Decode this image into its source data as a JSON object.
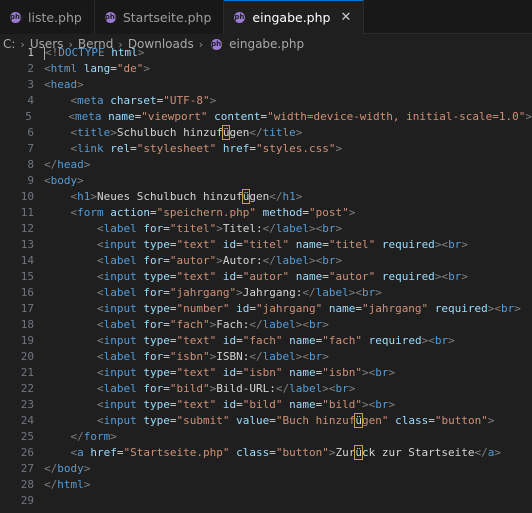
{
  "tabs": [
    {
      "label": "liste.php",
      "active": false
    },
    {
      "label": "Startseite.php",
      "active": false
    },
    {
      "label": "eingabe.php",
      "active": true
    }
  ],
  "close_glyph": "✕",
  "breadcrumb": [
    "C:",
    "Users",
    "Bernd",
    "Downloads",
    "eingabe.php"
  ],
  "breadcrumb_sep": "›",
  "php_icon_text": "php",
  "current_line": 1,
  "colors": {
    "tag": "#569cd6",
    "attr": "#9cdcfe",
    "string": "#ce9178",
    "text": "#d4d4d4",
    "punct": "#808080",
    "accent": "#0078d4"
  },
  "code_lines": [
    [
      [
        "t",
        "<!"
      ],
      [
        "tg",
        "DOCTYPE"
      ],
      [
        "tx",
        " "
      ],
      [
        "at",
        "html"
      ],
      [
        "t",
        ">"
      ]
    ],
    [
      [
        "t",
        "<"
      ],
      [
        "tg",
        "html"
      ],
      [
        "tx",
        " "
      ],
      [
        "at",
        "lang"
      ],
      [
        "tx",
        "="
      ],
      [
        "st",
        "\"de\""
      ],
      [
        "t",
        ">"
      ]
    ],
    [
      [
        "t",
        "<"
      ],
      [
        "tg",
        "head"
      ],
      [
        "t",
        ">"
      ]
    ],
    [
      [
        "tx",
        "    "
      ],
      [
        "t",
        "<"
      ],
      [
        "tg",
        "meta"
      ],
      [
        "tx",
        " "
      ],
      [
        "at",
        "charset"
      ],
      [
        "tx",
        "="
      ],
      [
        "st",
        "\"UTF-8\""
      ],
      [
        "t",
        ">"
      ]
    ],
    [
      [
        "tx",
        "    "
      ],
      [
        "t",
        "<"
      ],
      [
        "tg",
        "meta"
      ],
      [
        "tx",
        " "
      ],
      [
        "at",
        "name"
      ],
      [
        "tx",
        "="
      ],
      [
        "st",
        "\"viewport\""
      ],
      [
        "tx",
        " "
      ],
      [
        "at",
        "content"
      ],
      [
        "tx",
        "="
      ],
      [
        "st",
        "\"width=device-width, initial-scale=1.0\""
      ],
      [
        "t",
        ">"
      ]
    ],
    [
      [
        "tx",
        "    "
      ],
      [
        "t",
        "<"
      ],
      [
        "tg",
        "title"
      ],
      [
        "t",
        ">"
      ],
      [
        "tx",
        "Schulbuch hinzuf"
      ],
      [
        "hl",
        "ü"
      ],
      [
        "tx",
        "gen"
      ],
      [
        "t",
        "</"
      ],
      [
        "tg",
        "title"
      ],
      [
        "t",
        ">"
      ]
    ],
    [
      [
        "tx",
        "    "
      ],
      [
        "t",
        "<"
      ],
      [
        "tg",
        "link"
      ],
      [
        "tx",
        " "
      ],
      [
        "at",
        "rel"
      ],
      [
        "tx",
        "="
      ],
      [
        "st",
        "\"stylesheet\""
      ],
      [
        "tx",
        " "
      ],
      [
        "at",
        "href"
      ],
      [
        "tx",
        "="
      ],
      [
        "st",
        "\"styles.css\""
      ],
      [
        "t",
        ">"
      ]
    ],
    [
      [
        "t",
        "</"
      ],
      [
        "tg",
        "head"
      ],
      [
        "t",
        ">"
      ]
    ],
    [
      [
        "t",
        "<"
      ],
      [
        "tg",
        "body"
      ],
      [
        "t",
        ">"
      ]
    ],
    [
      [
        "tx",
        "    "
      ],
      [
        "t",
        "<"
      ],
      [
        "tg",
        "h1"
      ],
      [
        "t",
        ">"
      ],
      [
        "tx",
        "Neues Schulbuch hinzuf"
      ],
      [
        "hl",
        "ü"
      ],
      [
        "tx",
        "gen"
      ],
      [
        "t",
        "</"
      ],
      [
        "tg",
        "h1"
      ],
      [
        "t",
        ">"
      ]
    ],
    [
      [
        "tx",
        "    "
      ],
      [
        "t",
        "<"
      ],
      [
        "tg",
        "form"
      ],
      [
        "tx",
        " "
      ],
      [
        "at",
        "action"
      ],
      [
        "tx",
        "="
      ],
      [
        "st",
        "\"speichern.php\""
      ],
      [
        "tx",
        " "
      ],
      [
        "at",
        "method"
      ],
      [
        "tx",
        "="
      ],
      [
        "st",
        "\"post\""
      ],
      [
        "t",
        ">"
      ]
    ],
    [
      [
        "tx",
        "        "
      ],
      [
        "t",
        "<"
      ],
      [
        "tg",
        "label"
      ],
      [
        "tx",
        " "
      ],
      [
        "at",
        "for"
      ],
      [
        "tx",
        "="
      ],
      [
        "st",
        "\"titel\""
      ],
      [
        "t",
        ">"
      ],
      [
        "tx",
        "Titel:"
      ],
      [
        "t",
        "</"
      ],
      [
        "tg",
        "label"
      ],
      [
        "t",
        "><"
      ],
      [
        "tg",
        "br"
      ],
      [
        "t",
        ">"
      ]
    ],
    [
      [
        "tx",
        "        "
      ],
      [
        "t",
        "<"
      ],
      [
        "tg",
        "input"
      ],
      [
        "tx",
        " "
      ],
      [
        "at",
        "type"
      ],
      [
        "tx",
        "="
      ],
      [
        "st",
        "\"text\""
      ],
      [
        "tx",
        " "
      ],
      [
        "at",
        "id"
      ],
      [
        "tx",
        "="
      ],
      [
        "st",
        "\"titel\""
      ],
      [
        "tx",
        " "
      ],
      [
        "at",
        "name"
      ],
      [
        "tx",
        "="
      ],
      [
        "st",
        "\"titel\""
      ],
      [
        "tx",
        " "
      ],
      [
        "at",
        "required"
      ],
      [
        "t",
        "><"
      ],
      [
        "tg",
        "br"
      ],
      [
        "t",
        ">"
      ]
    ],
    [
      [
        "tx",
        "        "
      ],
      [
        "t",
        "<"
      ],
      [
        "tg",
        "label"
      ],
      [
        "tx",
        " "
      ],
      [
        "at",
        "for"
      ],
      [
        "tx",
        "="
      ],
      [
        "st",
        "\"autor\""
      ],
      [
        "t",
        ">"
      ],
      [
        "tx",
        "Autor:"
      ],
      [
        "t",
        "</"
      ],
      [
        "tg",
        "label"
      ],
      [
        "t",
        "><"
      ],
      [
        "tg",
        "br"
      ],
      [
        "t",
        ">"
      ]
    ],
    [
      [
        "tx",
        "        "
      ],
      [
        "t",
        "<"
      ],
      [
        "tg",
        "input"
      ],
      [
        "tx",
        " "
      ],
      [
        "at",
        "type"
      ],
      [
        "tx",
        "="
      ],
      [
        "st",
        "\"text\""
      ],
      [
        "tx",
        " "
      ],
      [
        "at",
        "id"
      ],
      [
        "tx",
        "="
      ],
      [
        "st",
        "\"autor\""
      ],
      [
        "tx",
        " "
      ],
      [
        "at",
        "name"
      ],
      [
        "tx",
        "="
      ],
      [
        "st",
        "\"autor\""
      ],
      [
        "tx",
        " "
      ],
      [
        "at",
        "required"
      ],
      [
        "t",
        "><"
      ],
      [
        "tg",
        "br"
      ],
      [
        "t",
        ">"
      ]
    ],
    [
      [
        "tx",
        "        "
      ],
      [
        "t",
        "<"
      ],
      [
        "tg",
        "label"
      ],
      [
        "tx",
        " "
      ],
      [
        "at",
        "for"
      ],
      [
        "tx",
        "="
      ],
      [
        "st",
        "\"jahrgang\""
      ],
      [
        "t",
        ">"
      ],
      [
        "tx",
        "Jahrgang:"
      ],
      [
        "t",
        "</"
      ],
      [
        "tg",
        "label"
      ],
      [
        "t",
        "><"
      ],
      [
        "tg",
        "br"
      ],
      [
        "t",
        ">"
      ]
    ],
    [
      [
        "tx",
        "        "
      ],
      [
        "t",
        "<"
      ],
      [
        "tg",
        "input"
      ],
      [
        "tx",
        " "
      ],
      [
        "at",
        "type"
      ],
      [
        "tx",
        "="
      ],
      [
        "st",
        "\"number\""
      ],
      [
        "tx",
        " "
      ],
      [
        "at",
        "id"
      ],
      [
        "tx",
        "="
      ],
      [
        "st",
        "\"jahrgang\""
      ],
      [
        "tx",
        " "
      ],
      [
        "at",
        "name"
      ],
      [
        "tx",
        "="
      ],
      [
        "st",
        "\"jahrgang\""
      ],
      [
        "tx",
        " "
      ],
      [
        "at",
        "required"
      ],
      [
        "t",
        "><"
      ],
      [
        "tg",
        "br"
      ],
      [
        "t",
        ">"
      ]
    ],
    [
      [
        "tx",
        "        "
      ],
      [
        "t",
        "<"
      ],
      [
        "tg",
        "label"
      ],
      [
        "tx",
        " "
      ],
      [
        "at",
        "for"
      ],
      [
        "tx",
        "="
      ],
      [
        "st",
        "\"fach\""
      ],
      [
        "t",
        ">"
      ],
      [
        "tx",
        "Fach:"
      ],
      [
        "t",
        "</"
      ],
      [
        "tg",
        "label"
      ],
      [
        "t",
        "><"
      ],
      [
        "tg",
        "br"
      ],
      [
        "t",
        ">"
      ]
    ],
    [
      [
        "tx",
        "        "
      ],
      [
        "t",
        "<"
      ],
      [
        "tg",
        "input"
      ],
      [
        "tx",
        " "
      ],
      [
        "at",
        "type"
      ],
      [
        "tx",
        "="
      ],
      [
        "st",
        "\"text\""
      ],
      [
        "tx",
        " "
      ],
      [
        "at",
        "id"
      ],
      [
        "tx",
        "="
      ],
      [
        "st",
        "\"fach\""
      ],
      [
        "tx",
        " "
      ],
      [
        "at",
        "name"
      ],
      [
        "tx",
        "="
      ],
      [
        "st",
        "\"fach\""
      ],
      [
        "tx",
        " "
      ],
      [
        "at",
        "required"
      ],
      [
        "t",
        "><"
      ],
      [
        "tg",
        "br"
      ],
      [
        "t",
        ">"
      ]
    ],
    [
      [
        "tx",
        "        "
      ],
      [
        "t",
        "<"
      ],
      [
        "tg",
        "label"
      ],
      [
        "tx",
        " "
      ],
      [
        "at",
        "for"
      ],
      [
        "tx",
        "="
      ],
      [
        "st",
        "\"isbn\""
      ],
      [
        "t",
        ">"
      ],
      [
        "tx",
        "ISBN:"
      ],
      [
        "t",
        "</"
      ],
      [
        "tg",
        "label"
      ],
      [
        "t",
        "><"
      ],
      [
        "tg",
        "br"
      ],
      [
        "t",
        ">"
      ]
    ],
    [
      [
        "tx",
        "        "
      ],
      [
        "t",
        "<"
      ],
      [
        "tg",
        "input"
      ],
      [
        "tx",
        " "
      ],
      [
        "at",
        "type"
      ],
      [
        "tx",
        "="
      ],
      [
        "st",
        "\"text\""
      ],
      [
        "tx",
        " "
      ],
      [
        "at",
        "id"
      ],
      [
        "tx",
        "="
      ],
      [
        "st",
        "\"isbn\""
      ],
      [
        "tx",
        " "
      ],
      [
        "at",
        "name"
      ],
      [
        "tx",
        "="
      ],
      [
        "st",
        "\"isbn\""
      ],
      [
        "t",
        "><"
      ],
      [
        "tg",
        "br"
      ],
      [
        "t",
        ">"
      ]
    ],
    [
      [
        "tx",
        "        "
      ],
      [
        "t",
        "<"
      ],
      [
        "tg",
        "label"
      ],
      [
        "tx",
        " "
      ],
      [
        "at",
        "for"
      ],
      [
        "tx",
        "="
      ],
      [
        "st",
        "\"bild\""
      ],
      [
        "t",
        ">"
      ],
      [
        "tx",
        "Bild-URL:"
      ],
      [
        "t",
        "</"
      ],
      [
        "tg",
        "label"
      ],
      [
        "t",
        "><"
      ],
      [
        "tg",
        "br"
      ],
      [
        "t",
        ">"
      ]
    ],
    [
      [
        "tx",
        "        "
      ],
      [
        "t",
        "<"
      ],
      [
        "tg",
        "input"
      ],
      [
        "tx",
        " "
      ],
      [
        "at",
        "type"
      ],
      [
        "tx",
        "="
      ],
      [
        "st",
        "\"text\""
      ],
      [
        "tx",
        " "
      ],
      [
        "at",
        "id"
      ],
      [
        "tx",
        "="
      ],
      [
        "st",
        "\"bild\""
      ],
      [
        "tx",
        " "
      ],
      [
        "at",
        "name"
      ],
      [
        "tx",
        "="
      ],
      [
        "st",
        "\"bild\""
      ],
      [
        "t",
        "><"
      ],
      [
        "tg",
        "br"
      ],
      [
        "t",
        ">"
      ]
    ],
    [
      [
        "tx",
        "        "
      ],
      [
        "t",
        "<"
      ],
      [
        "tg",
        "input"
      ],
      [
        "tx",
        " "
      ],
      [
        "at",
        "type"
      ],
      [
        "tx",
        "="
      ],
      [
        "st",
        "\"submit\""
      ],
      [
        "tx",
        " "
      ],
      [
        "at",
        "value"
      ],
      [
        "tx",
        "="
      ],
      [
        "st",
        "\"Buch hinzuf"
      ],
      [
        "hl",
        "ü"
      ],
      [
        "st",
        "gen\""
      ],
      [
        "tx",
        " "
      ],
      [
        "at",
        "class"
      ],
      [
        "tx",
        "="
      ],
      [
        "st",
        "\"button\""
      ],
      [
        "t",
        ">"
      ]
    ],
    [
      [
        "tx",
        "    "
      ],
      [
        "t",
        "</"
      ],
      [
        "tg",
        "form"
      ],
      [
        "t",
        ">"
      ]
    ],
    [
      [
        "tx",
        "    "
      ],
      [
        "t",
        "<"
      ],
      [
        "tg",
        "a"
      ],
      [
        "tx",
        " "
      ],
      [
        "at",
        "href"
      ],
      [
        "tx",
        "="
      ],
      [
        "st",
        "\"Startseite.php\""
      ],
      [
        "tx",
        " "
      ],
      [
        "at",
        "class"
      ],
      [
        "tx",
        "="
      ],
      [
        "st",
        "\"button\""
      ],
      [
        "t",
        ">"
      ],
      [
        "tx",
        "Zur"
      ],
      [
        "hl",
        "ü"
      ],
      [
        "tx",
        "ck zur Startseite"
      ],
      [
        "t",
        "</"
      ],
      [
        "tg",
        "a"
      ],
      [
        "t",
        ">"
      ]
    ],
    [
      [
        "t",
        "</"
      ],
      [
        "tg",
        "body"
      ],
      [
        "t",
        ">"
      ]
    ],
    [
      [
        "t",
        "</"
      ],
      [
        "tg",
        "html"
      ],
      [
        "t",
        ">"
      ]
    ],
    []
  ]
}
